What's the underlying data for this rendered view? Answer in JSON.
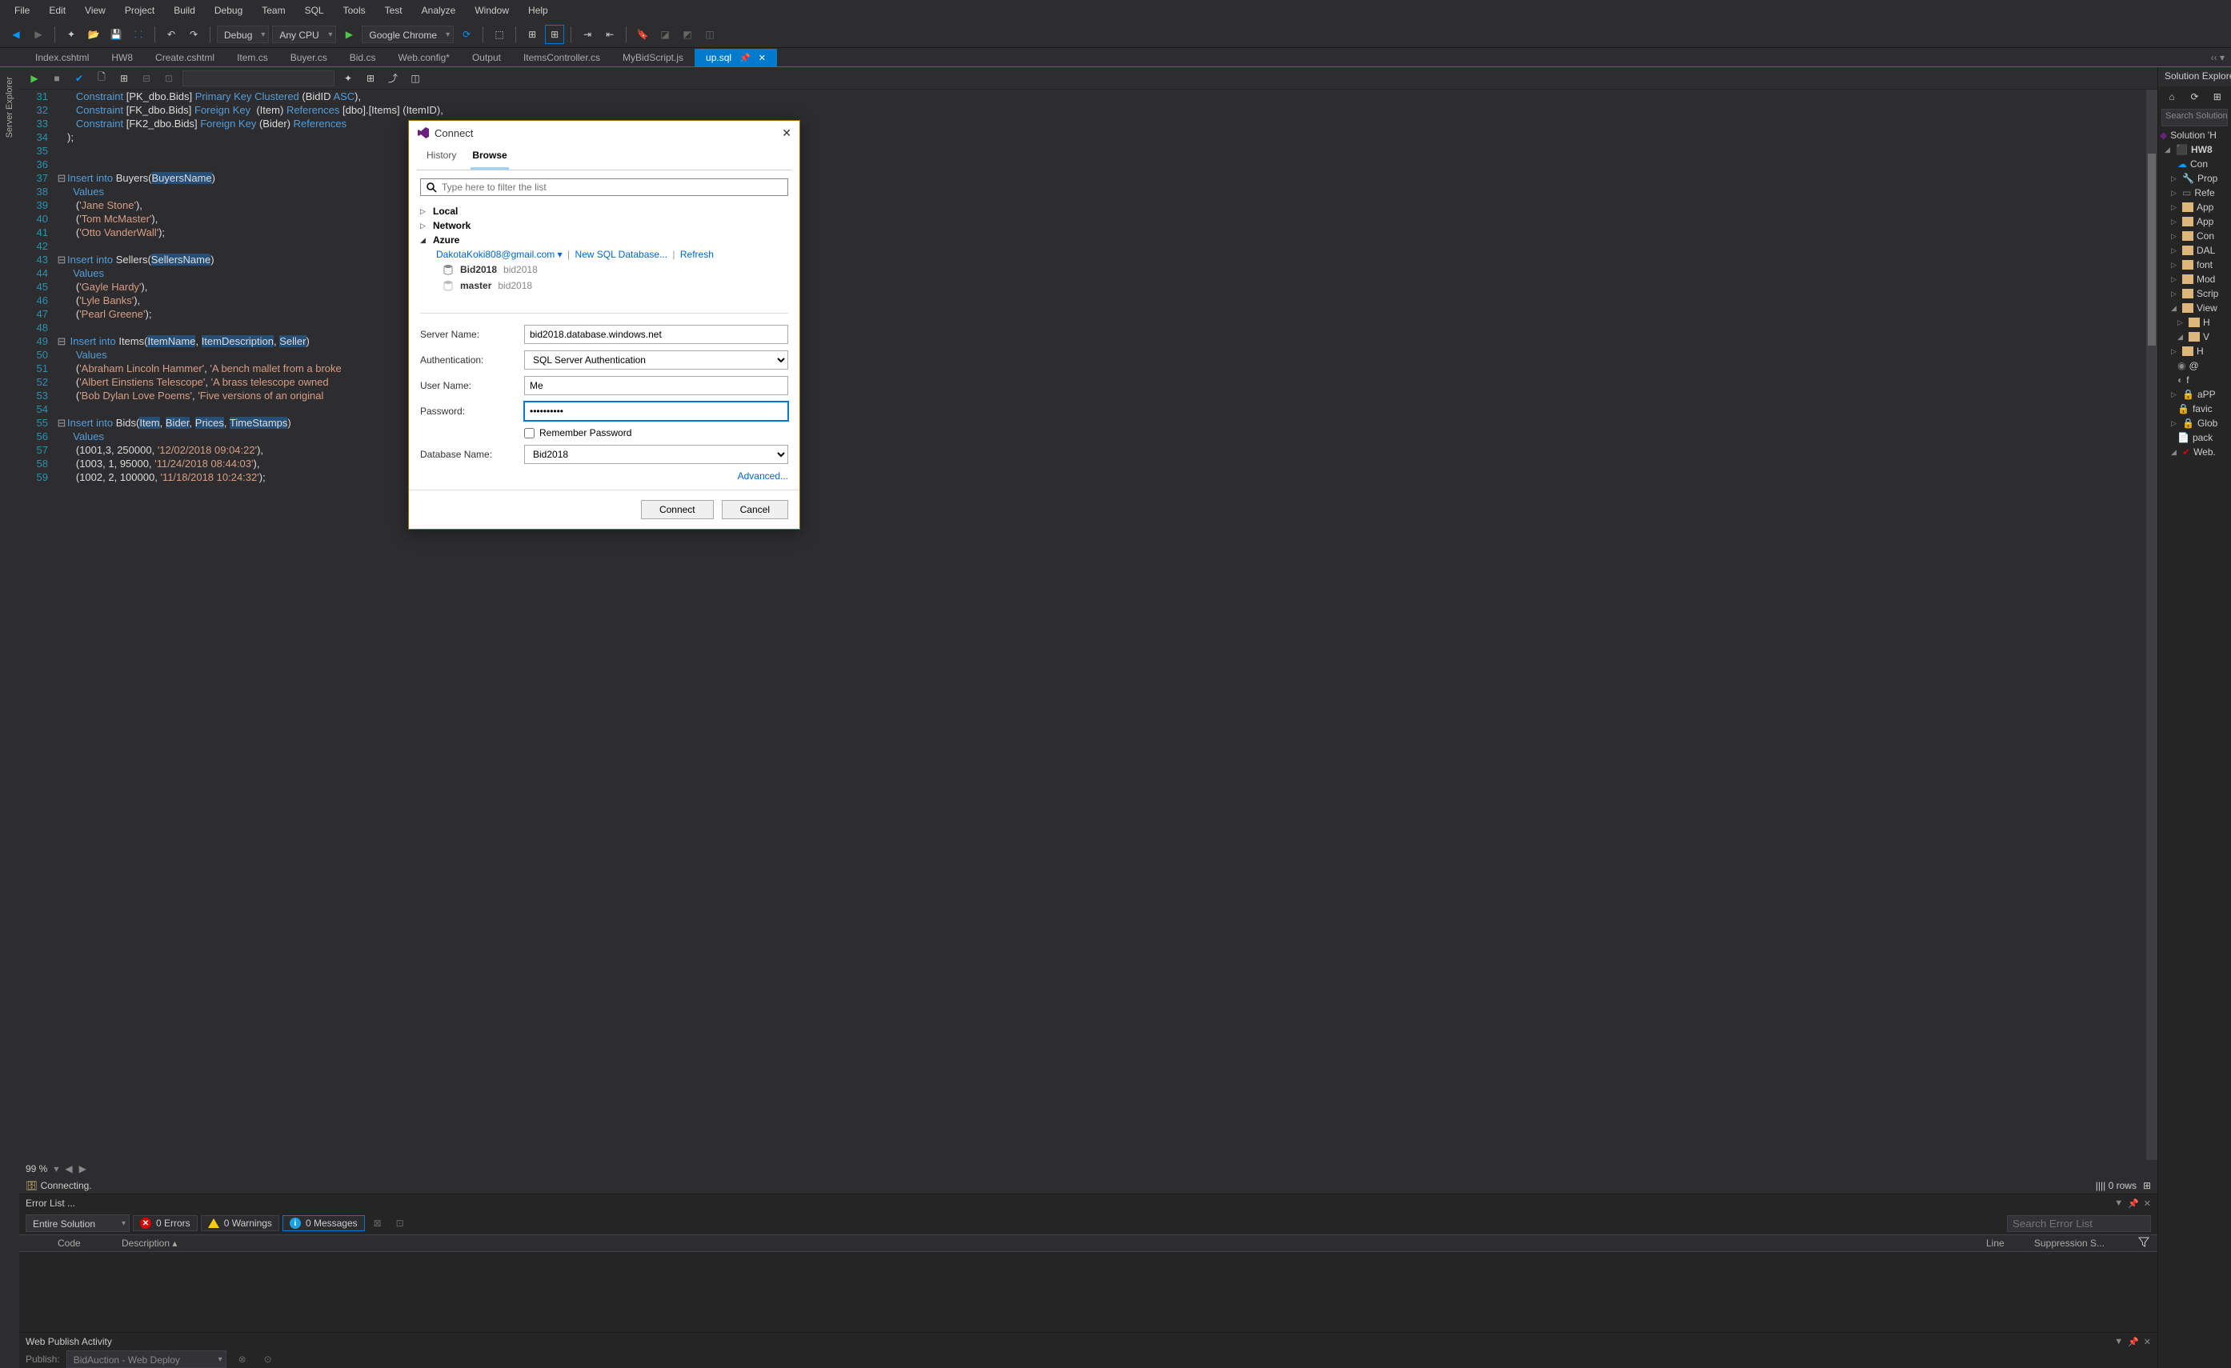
{
  "menu": {
    "items": [
      "File",
      "Edit",
      "View",
      "Project",
      "Build",
      "Debug",
      "Team",
      "SQL",
      "Tools",
      "Test",
      "Analyze",
      "Window",
      "Help"
    ]
  },
  "toolbar": {
    "config": "Debug",
    "platform": "Any CPU",
    "launch_target": "Google Chrome"
  },
  "tabs": [
    {
      "label": "Index.cshtml"
    },
    {
      "label": "HW8"
    },
    {
      "label": "Create.cshtml"
    },
    {
      "label": "Item.cs"
    },
    {
      "label": "Buyer.cs"
    },
    {
      "label": "Bid.cs"
    },
    {
      "label": "Web.config*"
    },
    {
      "label": "Output"
    },
    {
      "label": "ItemsController.cs"
    },
    {
      "label": "MyBidScript.js"
    },
    {
      "label": "up.sql",
      "active": true
    }
  ],
  "left_rail": {
    "label": "Server Explorer"
  },
  "code": {
    "lines": [
      {
        "n": 31,
        "html": "   <span class='kw'>Constraint</span> <span class='id'>[PK_dbo.Bids]</span> <span class='kw'>Primary Key Clustered</span> <span class='par'>(</span>BidID <span class='kw'>ASC</span><span class='par'>),</span>"
      },
      {
        "n": 32,
        "html": "   <span class='kw'>Constraint</span> <span class='id'>[FK_dbo.Bids]</span> <span class='kw'>Foreign Key</span>  <span class='par'>(</span>Item<span class='par'>)</span> <span class='kw'>References</span> <span class='id'>[dbo].[Items]</span> <span class='par'>(</span>ItemID<span class='par'>),</span>"
      },
      {
        "n": 33,
        "html": "   <span class='kw'>Constraint</span> <span class='id'>[FK2_dbo.Bids]</span> <span class='kw'>Foreign Key</span> <span class='par'>(</span>Bider<span class='par'>)</span> <span class='kw'>References</span>"
      },
      {
        "n": 34,
        "html": "<span class='par'>);</span>"
      },
      {
        "n": 35,
        "html": ""
      },
      {
        "n": 36,
        "html": ""
      },
      {
        "n": 37,
        "fold": "⊟",
        "html": "<span class='kw'>Insert into</span> Buyers<span class='par'>(</span><span class='hl'>BuyersName</span><span class='par'>)</span>"
      },
      {
        "n": 38,
        "html": "  <span class='kw'>Values</span>"
      },
      {
        "n": 39,
        "html": "   <span class='par'>(</span><span class='str'>'Jane Stone'</span><span class='par'>),</span>"
      },
      {
        "n": 40,
        "html": "   <span class='par'>(</span><span class='str'>'Tom McMaster'</span><span class='par'>),</span>"
      },
      {
        "n": 41,
        "html": "   <span class='par'>(</span><span class='str'>'Otto VanderWall'</span><span class='par'>);</span>"
      },
      {
        "n": 42,
        "html": ""
      },
      {
        "n": 43,
        "fold": "⊟",
        "html": "<span class='kw'>Insert into</span> Sellers<span class='par'>(</span><span class='hl'>SellersName</span><span class='par'>)</span>"
      },
      {
        "n": 44,
        "html": "  <span class='kw'>Values</span>"
      },
      {
        "n": 45,
        "html": "   <span class='par'>(</span><span class='str'>'Gayle Hardy'</span><span class='par'>),</span>"
      },
      {
        "n": 46,
        "html": "   <span class='par'>(</span><span class='str'>'Lyle Banks'</span><span class='par'>),</span>"
      },
      {
        "n": 47,
        "html": "   <span class='par'>(</span><span class='str'>'Pearl Greene'</span><span class='par'>);</span>"
      },
      {
        "n": 48,
        "html": ""
      },
      {
        "n": 49,
        "fold": "⊟",
        "html": " <span class='kw'>Insert into</span> Items<span class='par'>(</span><span class='hl'>ItemName</span><span class='par'>,</span> <span class='hl'>ItemDescription</span><span class='par'>,</span> <span class='hl'>Seller</span><span class='par'>)</span>"
      },
      {
        "n": 50,
        "html": "   <span class='kw'>Values</span>"
      },
      {
        "n": 51,
        "html": "   <span class='par'>(</span><span class='str'>'Abraham Lincoln Hammer'</span><span class='par'>,</span> <span class='str'>'A bench mallet from a broke</span>"
      },
      {
        "n": 52,
        "html": "   <span class='par'>(</span><span class='str'>'Albert Einstiens Telescope'</span><span class='par'>,</span> <span class='str'>'A brass telescope owned</span>"
      },
      {
        "n": 53,
        "html": "   <span class='par'>(</span><span class='str'>'Bob Dylan Love Poems'</span><span class='par'>,</span> <span class='str'>'Five versions of an original</span>"
      },
      {
        "n": 54,
        "html": ""
      },
      {
        "n": 55,
        "fold": "⊟",
        "html": "<span class='kw'>Insert into</span> Bids<span class='par'>(</span><span class='hl'>Item</span><span class='par'>,</span> <span class='hl'>Bider</span><span class='par'>,</span> <span class='hl'>Prices</span><span class='par'>,</span> <span class='hl'>TimeStamps</span><span class='par'>)</span>"
      },
      {
        "n": 56,
        "html": "  <span class='kw'>Values</span>"
      },
      {
        "n": 57,
        "html": "   <span class='par'>(</span>1001<span class='par'>,</span>3<span class='par'>,</span> 250000<span class='par'>,</span> <span class='str'>'12/02/2018 09:04:22'</span><span class='par'>),</span>"
      },
      {
        "n": 58,
        "html": "   <span class='par'>(</span>1003<span class='par'>,</span> 1<span class='par'>,</span> 95000<span class='par'>,</span> <span class='str'>'11/24/2018 08:44:03'</span><span class='par'>),</span>"
      },
      {
        "n": 59,
        "html": "   <span class='par'>(</span>1002<span class='par'>,</span> 2<span class='par'>,</span> 100000<span class='par'>,</span> <span class='str'>'11/18/2018 10:24:32'</span><span class='par'>);</span>"
      }
    ],
    "zoom": "99 %",
    "connecting": "Connecting.",
    "rows_status": "0 rows"
  },
  "error_list": {
    "title": "Error List ...",
    "scope": "Entire Solution",
    "errors": "0 Errors",
    "warnings": "0 Warnings",
    "messages": "0 Messages",
    "search_placeholder": "Search Error List",
    "columns": {
      "code": "Code",
      "desc": "Description",
      "line": "Line",
      "sup": "Suppression S..."
    }
  },
  "web_publish": {
    "title": "Web Publish Activity",
    "label": "Publish:",
    "profile": "BidAuction - Web Deploy"
  },
  "solution": {
    "title": "Solution Explorer",
    "search": "Search Solution",
    "root": "Solution 'H",
    "project": "HW8",
    "items": [
      "Con",
      "Prop",
      "Refe",
      "App",
      "App",
      "Con",
      "DAL",
      "font",
      "Mod",
      "Scrip",
      "View",
      "H",
      "V",
      "H",
      "@",
      "f",
      "aPP",
      "favic",
      "Glob",
      "pack",
      "Web."
    ]
  },
  "dialog": {
    "title": "Connect",
    "tabs": {
      "history": "History",
      "browse": "Browse"
    },
    "search_placeholder": "Type here to filter the list",
    "tree": {
      "local": "Local",
      "network": "Network",
      "azure": "Azure",
      "account": "DakotaKoki808@gmail.com",
      "new_db": "New SQL Database...",
      "refresh": "Refresh",
      "dbs": [
        {
          "name": "Bid2018",
          "server": "bid2018"
        },
        {
          "name": "master",
          "server": "bid2018"
        }
      ]
    },
    "form": {
      "server_label": "Server Name:",
      "server_value": "bid2018.database.windows.net",
      "auth_label": "Authentication:",
      "auth_value": "SQL Server Authentication",
      "user_label": "User Name:",
      "user_value": "Me",
      "pass_label": "Password:",
      "pass_value": "••••••••••",
      "remember": "Remember Password",
      "db_label": "Database Name:",
      "db_value": "Bid2018",
      "advanced": "Advanced..."
    },
    "buttons": {
      "connect": "Connect",
      "cancel": "Cancel"
    }
  }
}
